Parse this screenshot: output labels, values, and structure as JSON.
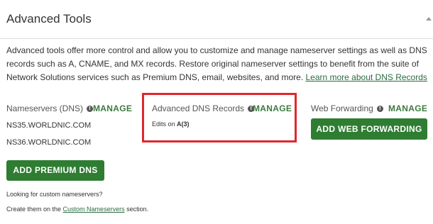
{
  "header": {
    "title": "Advanced Tools"
  },
  "description": {
    "text": "Advanced tools offer more control and allow you to customize and manage nameserver settings as well as DNS records such as A, CNAME, and MX records. Restore original nameserver settings to benefit from the suite of Network Solutions services such as Premium DNS, email, websites, and more. ",
    "link_label": "Learn more about DNS Records"
  },
  "nameservers": {
    "label": "Nameservers (DNS)",
    "manage_label": "MANAGE",
    "values": [
      "NS35.WORLDNIC.COM",
      "NS36.WORLDNIC.COM"
    ],
    "button_label": "ADD PREMIUM DNS"
  },
  "advanced_dns": {
    "label": "Advanced DNS Records",
    "manage_label": "MANAGE",
    "edits_prefix": "Edits on ",
    "edits_value": "A(3)"
  },
  "web_forwarding": {
    "label": "Web Forwarding",
    "manage_label": "MANAGE",
    "button_label": "ADD WEB FORWARDING"
  },
  "footer": {
    "line1": "Looking for custom nameservers?",
    "line2_prefix": "Create them on the ",
    "line2_link": "Custom Nameservers",
    "line2_suffix": " section."
  },
  "colors": {
    "accent_green": "#2f7d32",
    "link_green": "#2a6b3f",
    "highlight_red": "#e0262e"
  },
  "icons": [
    "info-icon",
    "scroll-up-arrow-icon"
  ]
}
